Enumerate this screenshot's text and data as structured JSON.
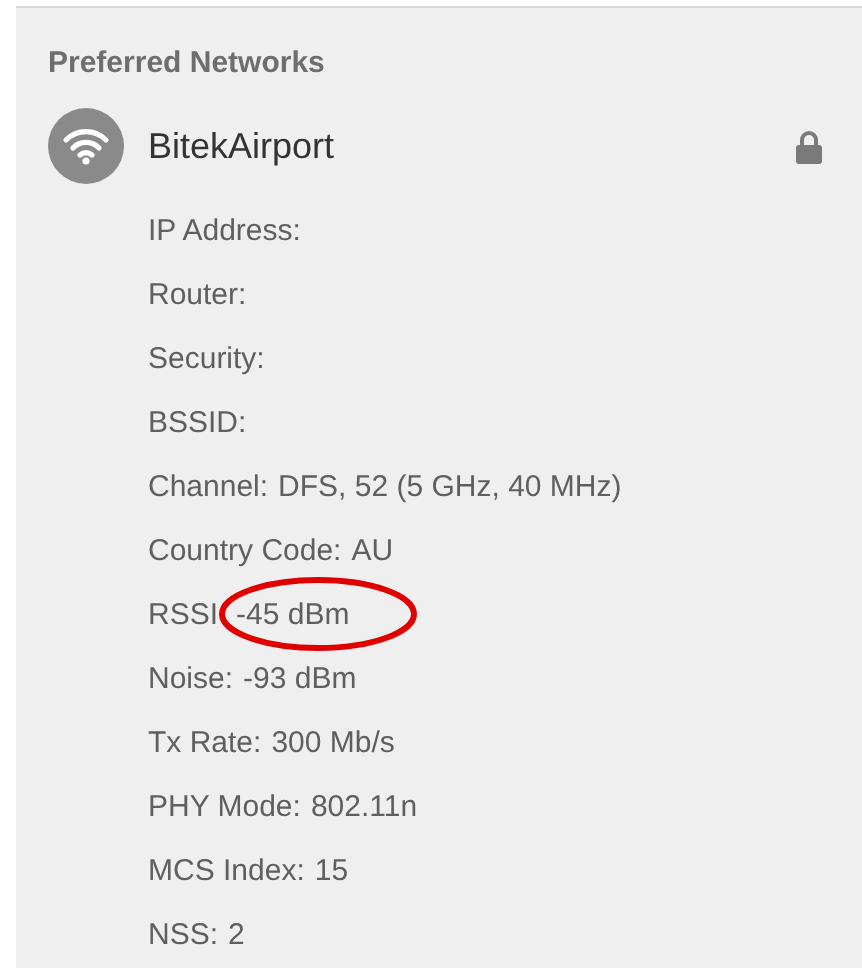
{
  "section": {
    "title": "Preferred Networks"
  },
  "network": {
    "name": "BitekAirport",
    "locked": true,
    "details": [
      {
        "label": "IP Address:"
      },
      {
        "label": "Router:"
      },
      {
        "label": "Security:"
      },
      {
        "label": "BSSID:"
      },
      {
        "label": "Channel:",
        "value": "DFS, 52 (5 GHz, 40 MHz)"
      },
      {
        "label": "Country Code:",
        "value": "AU"
      },
      {
        "label": "RSSI",
        "value": "-45 dBm",
        "circled": true
      },
      {
        "label": "Noise:",
        "value": "-93 dBm"
      },
      {
        "label": "Tx Rate:",
        "value": "300 Mb/s"
      },
      {
        "label": "PHY Mode:",
        "value": "802.11n"
      },
      {
        "label": "MCS Index:",
        "value": "15"
      },
      {
        "label": "NSS:",
        "value": "2"
      }
    ]
  }
}
